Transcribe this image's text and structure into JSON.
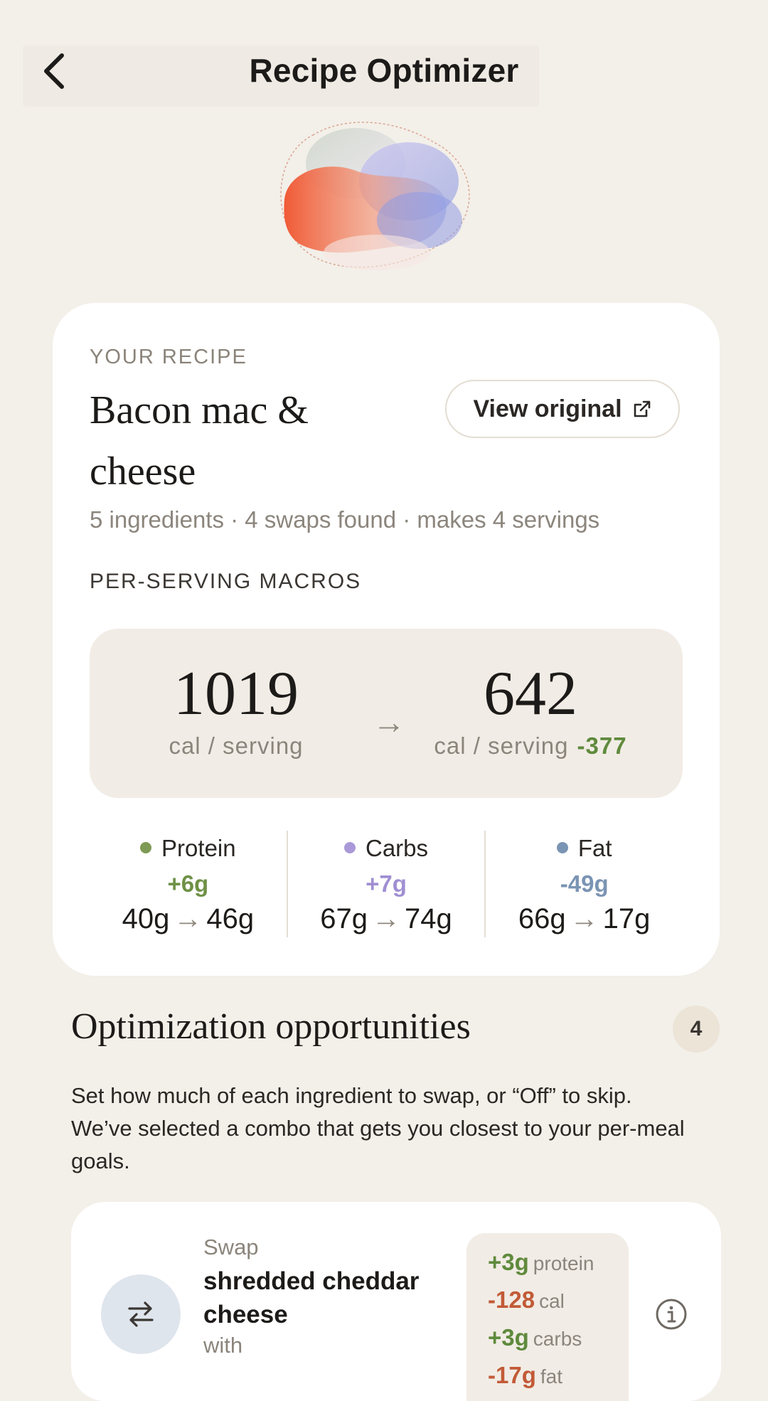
{
  "header": {
    "title": "Recipe Optimizer"
  },
  "recipe": {
    "eyebrow": "YOUR RECIPE",
    "name": "Bacon mac & cheese",
    "view_original_label": "View original",
    "meta": "5 ingredients · 4 swaps found · makes 4 servings",
    "macros_label": "PER-SERVING MACROS",
    "calories": {
      "before": "1019",
      "after": "642",
      "unit_before": "cal / serving",
      "unit_after": "cal / serving",
      "delta": "-377"
    },
    "macros": [
      {
        "name": "Protein",
        "delta": "+6g",
        "before": "40g",
        "after": "46g",
        "color": "#7f9a55"
      },
      {
        "name": "Carbs",
        "delta": "+7g",
        "before": "67g",
        "after": "74g",
        "color": "#a999d8"
      },
      {
        "name": "Fat",
        "delta": "-49g",
        "before": "66g",
        "after": "17g",
        "color": "#7a94b3"
      }
    ]
  },
  "optimization": {
    "title": "Optimization opportunities",
    "count": "4",
    "description": "Set how much of each ingredient to swap, or “Off” to skip. We’ve selected a combo that gets you closest to your per-meal goals.",
    "swap": {
      "label": "Swap",
      "from": "shredded cheddar cheese",
      "with_label": "with",
      "impacts": [
        {
          "value": "+3g",
          "unit": "protein"
        },
        {
          "value": "-128",
          "unit": "cal"
        },
        {
          "value": "+3g",
          "unit": "carbs"
        },
        {
          "value": "-17g",
          "unit": "fat"
        }
      ]
    }
  },
  "colors": {
    "background": "#f3efe9",
    "positive": "#5f8a3c",
    "negative": "#c25a37",
    "protein": "#7f9a55",
    "carbs": "#a999d8",
    "fat": "#7a94b3"
  }
}
